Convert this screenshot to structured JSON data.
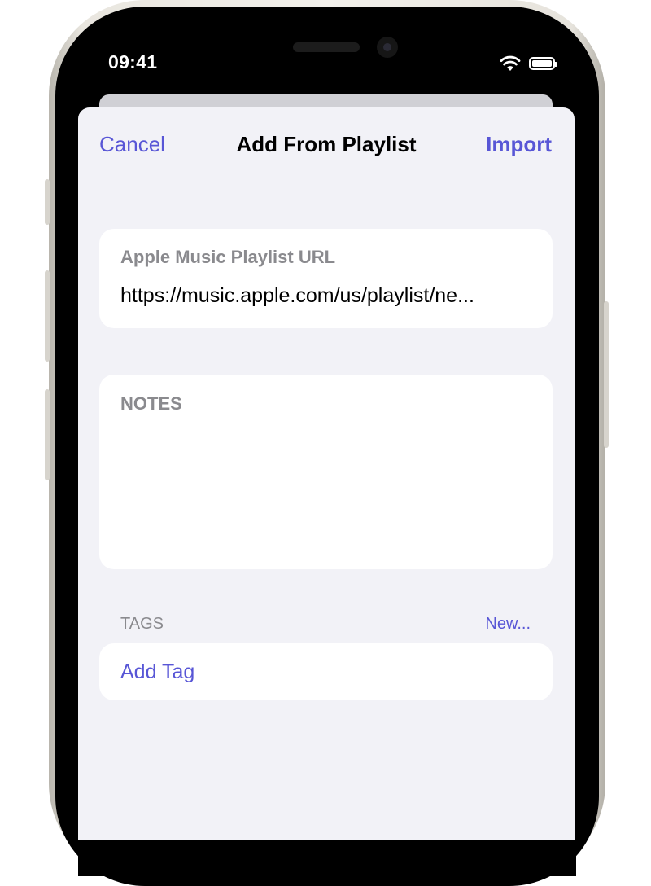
{
  "status_bar": {
    "time": "09:41",
    "icons": [
      "wifi-icon",
      "battery-icon"
    ]
  },
  "nav": {
    "cancel_label": "Cancel",
    "title": "Add From Playlist",
    "import_label": "Import"
  },
  "url_field": {
    "label": "Apple Music Playlist URL",
    "value": "https://music.apple.com/us/playlist/ne..."
  },
  "notes_field": {
    "label": "NOTES",
    "value": ""
  },
  "tags_section": {
    "header": "TAGS",
    "new_label": "New...",
    "add_tag_label": "Add Tag"
  },
  "colors": {
    "accent": "#5856d6",
    "background": "#f2f2f7",
    "secondary_text": "#8a8a8e"
  }
}
